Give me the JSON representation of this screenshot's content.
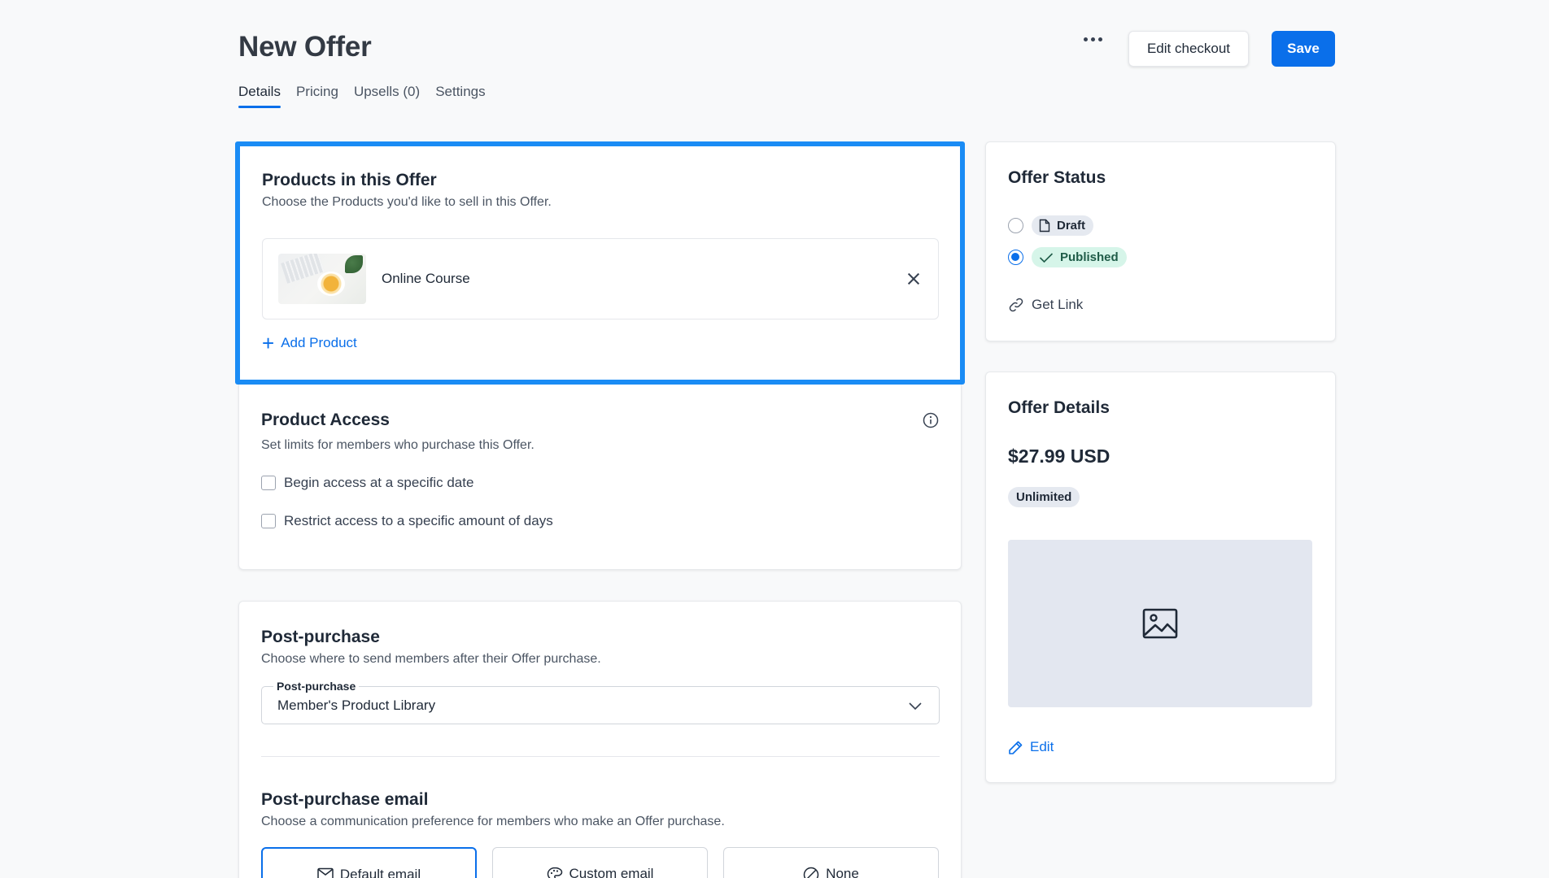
{
  "header": {
    "title": "New Offer",
    "more_icon": "more-horizontal-icon",
    "edit_checkout_label": "Edit checkout",
    "save_label": "Save"
  },
  "tabs": [
    {
      "label": "Details",
      "active": true
    },
    {
      "label": "Pricing",
      "active": false
    },
    {
      "label": "Upsells (0)",
      "active": false
    },
    {
      "label": "Settings",
      "active": false
    }
  ],
  "products": {
    "title": "Products in this Offer",
    "subtitle": "Choose the Products you'd like to sell in this Offer.",
    "items": [
      {
        "name": "Online Course"
      }
    ],
    "add_label": "Add Product"
  },
  "access": {
    "title": "Product Access",
    "subtitle": "Set limits for members who purchase this Offer.",
    "options": [
      {
        "label": "Begin access at a specific date",
        "checked": false
      },
      {
        "label": "Restrict access to a specific amount of days",
        "checked": false
      }
    ]
  },
  "post_purchase": {
    "title": "Post-purchase",
    "subtitle": "Choose where to send members after their Offer purchase.",
    "select_label": "Post-purchase",
    "select_value": "Member's Product Library",
    "email_title": "Post-purchase email",
    "email_subtitle": "Choose a communication preference for members who make an Offer purchase.",
    "email_options": [
      {
        "label": "Default email",
        "icon": "mail-icon",
        "selected": true
      },
      {
        "label": "Custom email",
        "icon": "palette-icon",
        "selected": false
      },
      {
        "label": "None",
        "icon": "ban-icon",
        "selected": false
      }
    ]
  },
  "status": {
    "title": "Offer Status",
    "options": [
      {
        "label": "Draft",
        "icon": "file-icon",
        "checked": false
      },
      {
        "label": "Published",
        "icon": "check-icon",
        "checked": true
      }
    ],
    "get_link_label": "Get Link"
  },
  "details": {
    "title": "Offer Details",
    "price": "$27.99 USD",
    "badge": "Unlimited",
    "edit_label": "Edit"
  },
  "colors": {
    "accent": "#0a6fea",
    "highlight_border": "#1a8cf5",
    "published_bg": "#d6f5e9"
  }
}
